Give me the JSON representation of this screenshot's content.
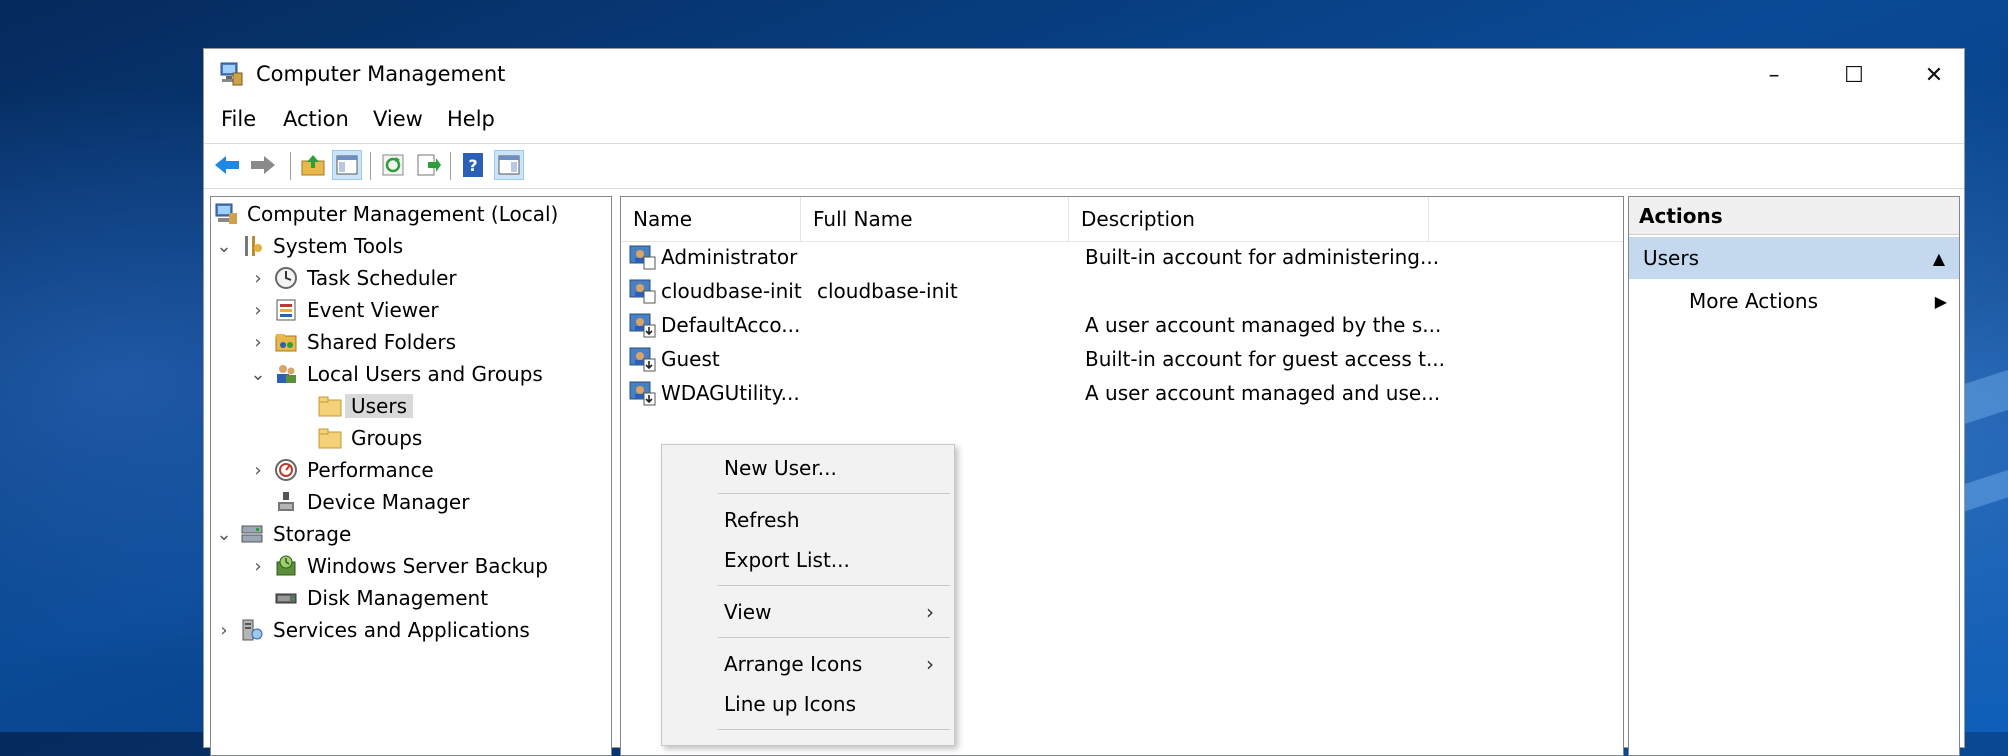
{
  "window": {
    "title": "Computer Management",
    "controls": {
      "minimize": "–",
      "maximize": "☐",
      "close": "✕"
    }
  },
  "menubar": [
    "File",
    "Action",
    "View",
    "Help"
  ],
  "toolbar": {
    "icons": [
      "back-icon",
      "forward-icon",
      "up-folder-icon",
      "show-hide-tree-icon",
      "refresh-icon",
      "export-list-icon",
      "help-icon",
      "show-hide-action-pane-icon"
    ]
  },
  "tree": {
    "root": "Computer Management (Local)",
    "system_tools": "System Tools",
    "task_scheduler": "Task Scheduler",
    "event_viewer": "Event Viewer",
    "shared_folders": "Shared Folders",
    "local_users_groups": "Local Users and Groups",
    "users": "Users",
    "groups": "Groups",
    "performance": "Performance",
    "device_manager": "Device Manager",
    "storage": "Storage",
    "windows_server_backup": "Windows Server Backup",
    "disk_management": "Disk Management",
    "services_applications": "Services and Applications"
  },
  "list": {
    "columns": [
      "Name",
      "Full Name",
      "Description"
    ],
    "rows": [
      {
        "name": "Administrator",
        "full_name": "",
        "description": "Built-in account for administering..."
      },
      {
        "name": "cloudbase-init",
        "full_name": "cloudbase-init",
        "description": ""
      },
      {
        "name": "DefaultAcco...",
        "full_name": "",
        "description": "A user account managed by the s..."
      },
      {
        "name": "Guest",
        "full_name": "",
        "description": "Built-in account for guest access t..."
      },
      {
        "name": "WDAGUtility...",
        "full_name": "",
        "description": "A user account managed and use..."
      }
    ]
  },
  "actions": {
    "title": "Actions",
    "section": "Users",
    "more": "More Actions"
  },
  "context_menu": {
    "new_user": "New User...",
    "refresh": "Refresh",
    "export_list": "Export List...",
    "view": "View",
    "arrange_icons": "Arrange Icons",
    "line_up_icons": "Line up Icons"
  },
  "colors": {
    "selection": "#cce4f7",
    "actions_section": "#c5d9ee",
    "desktop": "#0a4a96"
  }
}
